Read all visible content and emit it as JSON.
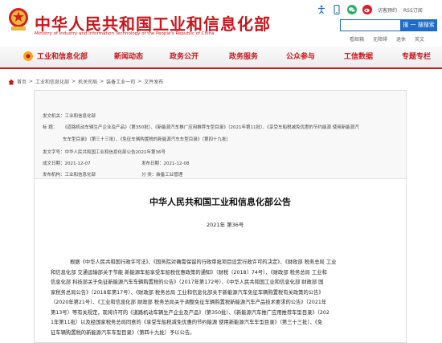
{
  "header": {
    "site_title": "中华人民共和国工业和信息化部",
    "site_subtitle": "Ministry of Industry and Information Technology of the People's Republic of China",
    "tools": {
      "visitor_label": "访客预约",
      "rss_label": "RSS订阅"
    },
    "search": {
      "button_label": "搜 一 搜搜索",
      "placeholder": ""
    },
    "quicklinks": [
      "看邮箱",
      "无障碍",
      "退休",
      "英文"
    ]
  },
  "nav": {
    "items": [
      "工业和信息化部",
      "新闻动态",
      "政务公开",
      "政务服务",
      "公众参与",
      "工信数据",
      "专题专栏"
    ]
  },
  "breadcrumb": [
    "首页",
    "工业和信息化部",
    "机关司局",
    "装备工业一司",
    "文件发布"
  ],
  "meta": {
    "issuer_label": "发文机关：",
    "issuer_value": "工业和信息化部",
    "subject_label": "标        题：",
    "subject_line1": "《道路机动车辆生产企业及产品》（第350批）、《新能源汽车推广应用推荐车型目录》（2021年第11批）、《享受车船税减免优惠的节约能源 使用新能源汽",
    "subject_line2": "车车型目录》（第三十三批）、《免征车辆购置税的新能源汽车车型目录》（第四十九批）",
    "docno_label": "发文字号：",
    "docno_value": "中华人民共和国工业和信息化部公告2021年第36号",
    "date_label": "成文日期：",
    "date_value": "2021-12-07",
    "pubdate_label": "发布日期：",
    "pubdate_value": "2021-12-08",
    "author_label": "发布机构：",
    "author_value": "工业和信息化部",
    "category_label": "分        类：",
    "category_value": "装备工业管理"
  },
  "document": {
    "title": "中华人民共和国工业和信息化部公告",
    "number": "2021年    第36号",
    "body_lines": [
      "根据《中华人民共和国行政许可法》、《国务院对确需保留的行政审批项目设定行政许可的决定》、《财政部  税务总局  工业",
      "和信息化部  交通运输部关于节能  新能源车船享受车船税优惠政策的通知》（财税〔2018〕74号）、《财政部  税务总局  工业和",
      "信息化部  科技部关于免征新能源汽车车辆购置税的公告》（2017年第172号）、《中华人民共和国工业和信息化部  财政部  国",
      "家税务总局公告》（2018年第17号）、《财政部  税务总局  工业和信息化部关于新能源汽车免征车辆购置税有关政策的公告》",
      "（2020年第21号）、《工业和信息化部    财政部  税务总局关于调整免征车辆购置税新能源汽车产品技术要求的公告》（2021年",
      "第13号）等有关规定，现将许可的《道路机动车辆生产企业及产品》（第350批）、《新能源汽车推广应用推荐车型目录》（202",
      "1年第11批）以及经国家税务总局同意的《享受车船税减免优惠的节约能源  使用新能源汽车车型目录》（第三十三批）、《免",
      "征车辆购置税的新能源汽车车型目录》（第四十九批）予以公告。"
    ]
  },
  "colors": {
    "brand_red": "#c8161d",
    "search_blue": "#1e6cc7"
  },
  "icons": [
    "emblem-icon",
    "accessibility-icon",
    "mobile-icon",
    "wechat-icon",
    "weibo-icon",
    "search-icon",
    "home-icon",
    "nav-icon"
  ]
}
